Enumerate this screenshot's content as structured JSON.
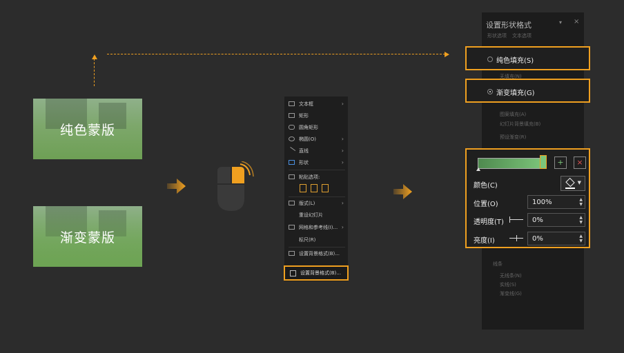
{
  "thumbnails": {
    "solid_label": "纯色蒙版",
    "gradient_label": "渐变蒙版"
  },
  "context_menu": {
    "items": [
      {
        "label": "文本框",
        "arrow": "›"
      },
      {
        "label": "矩形",
        "arrow": ""
      },
      {
        "label": "圆角矩形",
        "arrow": ""
      },
      {
        "label": "椭圆(O)",
        "arrow": "›"
      },
      {
        "label": "直线",
        "arrow": "›"
      },
      {
        "label": "形状",
        "arrow": "›"
      },
      {
        "label": "粘贴选项:",
        "arrow": ""
      },
      {
        "label": "版式(L)",
        "arrow": "›"
      },
      {
        "label": "重设幻灯片",
        "arrow": ""
      },
      {
        "label": "网格和参考线(I)...",
        "arrow": "›"
      },
      {
        "label": "标尺(R)",
        "arrow": ""
      },
      {
        "label": "设置背景格式(B)...",
        "arrow": ""
      }
    ],
    "highlighted": "设置背景格式(B)..."
  },
  "panel": {
    "title": "设置形状格式",
    "tab_shape": "形状选项",
    "tab_text": "文本选项",
    "dropdown_icon": "▾",
    "close_icon": "×",
    "faint_none": "无填充(N)",
    "faint_picture": "图案填充(A)",
    "faint_slide": "幻灯片背景填充(B)",
    "faint_preset": "预设渐变(R)",
    "faint_line": "线条",
    "faint_noline": "无线条(N)",
    "faint_solidline": "实线(S)",
    "faint_gradline": "渐变线(G)"
  },
  "fill": {
    "solid": "纯色填充(S)",
    "gradient": "渐变填充(G)"
  },
  "gradient": {
    "color_label": "颜色(C)",
    "position_label": "位置(O)",
    "position_value": "100%",
    "transparency_label": "透明度(T)",
    "transparency_value": "0%",
    "brightness_label": "亮度(I)",
    "brightness_value": "0%",
    "accent": "#f0a020",
    "green": "#7cc57a"
  }
}
